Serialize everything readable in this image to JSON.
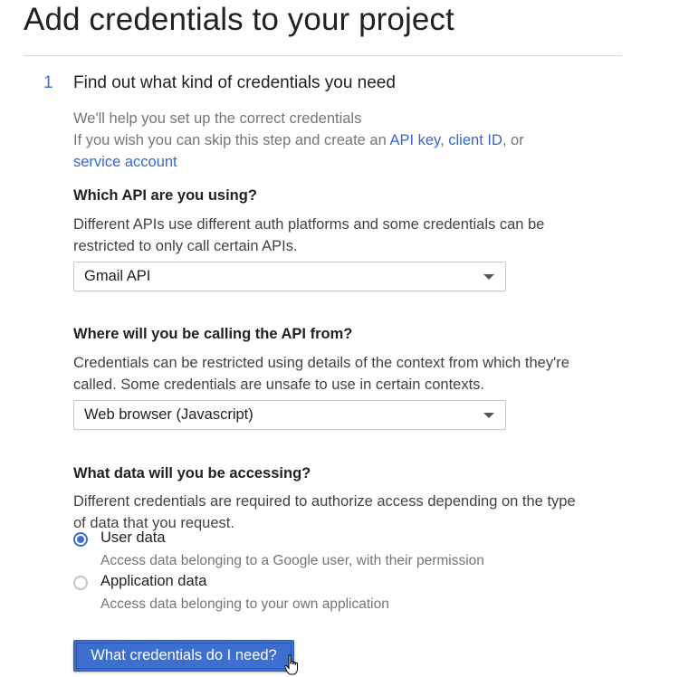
{
  "page": {
    "title": "Add credentials to your project"
  },
  "step": {
    "number": "1",
    "title": "Find out what kind of credentials you need"
  },
  "intro": {
    "line1": "We'll help you set up the correct credentials",
    "line2_prefix": "If you wish you can skip this step and create an ",
    "link_api_key": "API key",
    "sep1": ", ",
    "link_client_id": "client ID",
    "sep2": ", or",
    "link_service_account": "service account"
  },
  "api_question": {
    "title": "Which API are you using?",
    "description": "Different APIs use different auth platforms and some credentials can be restricted to only call certain APIs.",
    "selected": "Gmail API"
  },
  "source_question": {
    "title": "Where will you be calling the API from?",
    "description": "Credentials can be restricted using details of the context from which they're called. Some credentials are unsafe to use in certain contexts.",
    "selected": "Web browser (Javascript)"
  },
  "data_question": {
    "title": "What data will you be accessing?",
    "description": "Different credentials are required to authorize access depending on the type of data that you request.",
    "options": [
      {
        "label": "User data",
        "description": "Access data belonging to a Google user, with their permission",
        "checked": true
      },
      {
        "label": "Application data",
        "description": "Access data belonging to your own application",
        "checked": false
      }
    ]
  },
  "submit": {
    "label": "What credentials do I need?"
  },
  "colors": {
    "accent": "#3c6fd0",
    "link": "#3367d6",
    "muted_text": "#757575"
  },
  "icons": {
    "cursor": "hand-pointer-icon",
    "dropdown": "caret-down-icon"
  }
}
